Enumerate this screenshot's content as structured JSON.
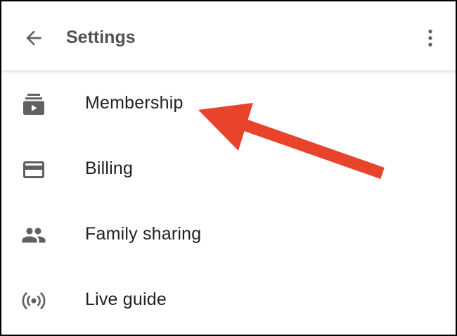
{
  "header": {
    "title": "Settings",
    "back_icon": "arrow-back-icon",
    "more_icon": "more-vert-icon"
  },
  "menu": {
    "items": [
      {
        "label": "Membership",
        "icon": "subscriptions-icon"
      },
      {
        "label": "Billing",
        "icon": "credit-card-icon"
      },
      {
        "label": "Family sharing",
        "icon": "people-icon"
      },
      {
        "label": "Live guide",
        "icon": "live-broadcast-icon"
      }
    ]
  },
  "annotation": {
    "arrow_color": "#E8432B",
    "points_to": "Membership"
  },
  "colors": {
    "icon_gray": "#606060",
    "title_gray": "#505050",
    "text_dark": "#212121"
  }
}
